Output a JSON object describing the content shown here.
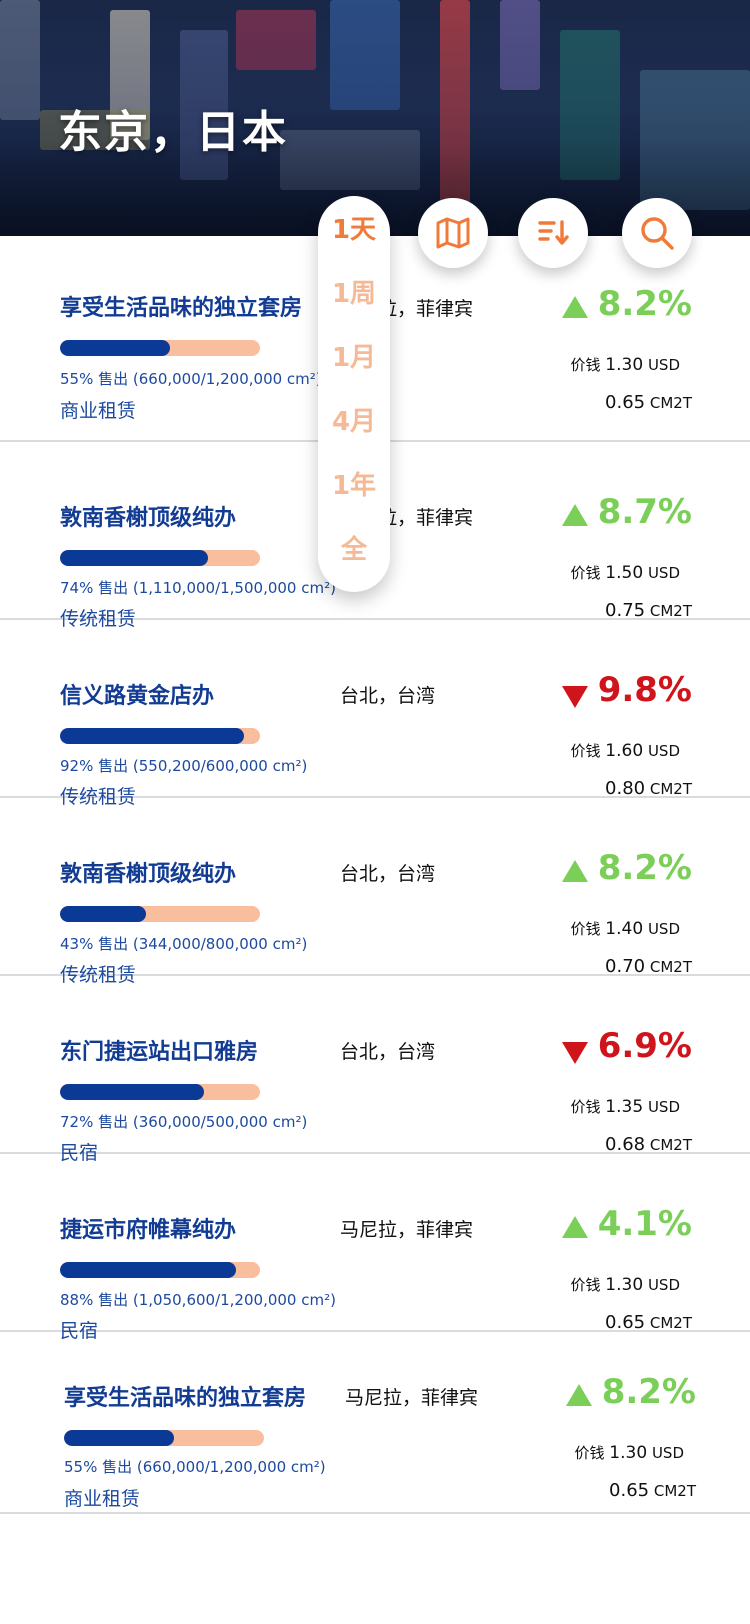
{
  "header": {
    "title": "东京，日本"
  },
  "period_options": [
    "1天",
    "1周",
    "1月",
    "4月",
    "1年",
    "全"
  ],
  "period_selected": "1天",
  "actions": {
    "map_icon": "map-icon",
    "sort_icon": "sort-descending-icon",
    "search_icon": "search-icon"
  },
  "colors": {
    "accent": "#f07a3a",
    "up": "#7bcf58",
    "down": "#d0141b",
    "brand_blue": "#123c93",
    "bar_fill": "#0a3a96",
    "bar_track": "#f8be9d"
  },
  "listings": [
    {
      "name": "享受生活品味的独立套房",
      "location": "马尼拉，菲律宾",
      "progress": 0.55,
      "sold": "55% 售出 (660,000/1,200,000 cm²)",
      "type": "商业租赁",
      "direction": "up",
      "change": "8.2%",
      "price_label": "价钱",
      "price_value": "1.30",
      "price_unit": "USD",
      "cm2t_value": "0.65",
      "cm2t_unit": "CM2T"
    },
    {
      "name": "敦南香榭顶级纯办",
      "location": "马尼拉，菲律宾",
      "progress": 0.74,
      "sold": "74% 售出 (1,110,000/1,500,000 cm²)",
      "type": "传统租赁",
      "direction": "up",
      "change": "8.7%",
      "price_label": "价钱",
      "price_value": "1.50",
      "price_unit": "USD",
      "cm2t_value": "0.75",
      "cm2t_unit": "CM2T"
    },
    {
      "name": "信义路黄金店办",
      "location": "台北，台湾",
      "progress": 0.92,
      "sold": "92% 售出 (550,200/600,000 cm²)",
      "type": "传统租赁",
      "direction": "down",
      "change": "9.8%",
      "price_label": "价钱",
      "price_value": "1.60",
      "price_unit": "USD",
      "cm2t_value": "0.80",
      "cm2t_unit": "CM2T"
    },
    {
      "name": "敦南香榭顶级纯办",
      "location": "台北，台湾",
      "progress": 0.43,
      "sold": "43% 售出 (344,000/800,000 cm²)",
      "type": "传统租赁",
      "direction": "up",
      "change": "8.2%",
      "price_label": "价钱",
      "price_value": "1.40",
      "price_unit": "USD",
      "cm2t_value": "0.70",
      "cm2t_unit": "CM2T"
    },
    {
      "name": "东门捷运站出口雅房",
      "location": "台北，台湾",
      "progress": 0.72,
      "sold": "72% 售出 (360,000/500,000 cm²)",
      "type": "民宿",
      "direction": "down",
      "change": "6.9%",
      "price_label": "价钱",
      "price_value": "1.35",
      "price_unit": "USD",
      "cm2t_value": "0.68",
      "cm2t_unit": "CM2T"
    },
    {
      "name": "捷运市府帷幕纯办",
      "location": "马尼拉，菲律宾",
      "progress": 0.88,
      "sold": "88% 售出 (1,050,600/1,200,000 cm²)",
      "type": "民宿",
      "direction": "up",
      "change": "4.1%",
      "price_label": "价钱",
      "price_value": "1.30",
      "price_unit": "USD",
      "cm2t_value": "0.65",
      "cm2t_unit": "CM2T"
    },
    {
      "name": "享受生活品味的独立套房",
      "location": "马尼拉，菲律宾",
      "progress": 0.55,
      "sold": "55% 售出 (660,000/1,200,000 cm²)",
      "type": "商业租赁",
      "direction": "up",
      "change": "8.2%",
      "price_label": "价钱",
      "price_value": "1.30",
      "price_unit": "USD",
      "cm2t_value": "0.65",
      "cm2t_unit": "CM2T"
    }
  ]
}
